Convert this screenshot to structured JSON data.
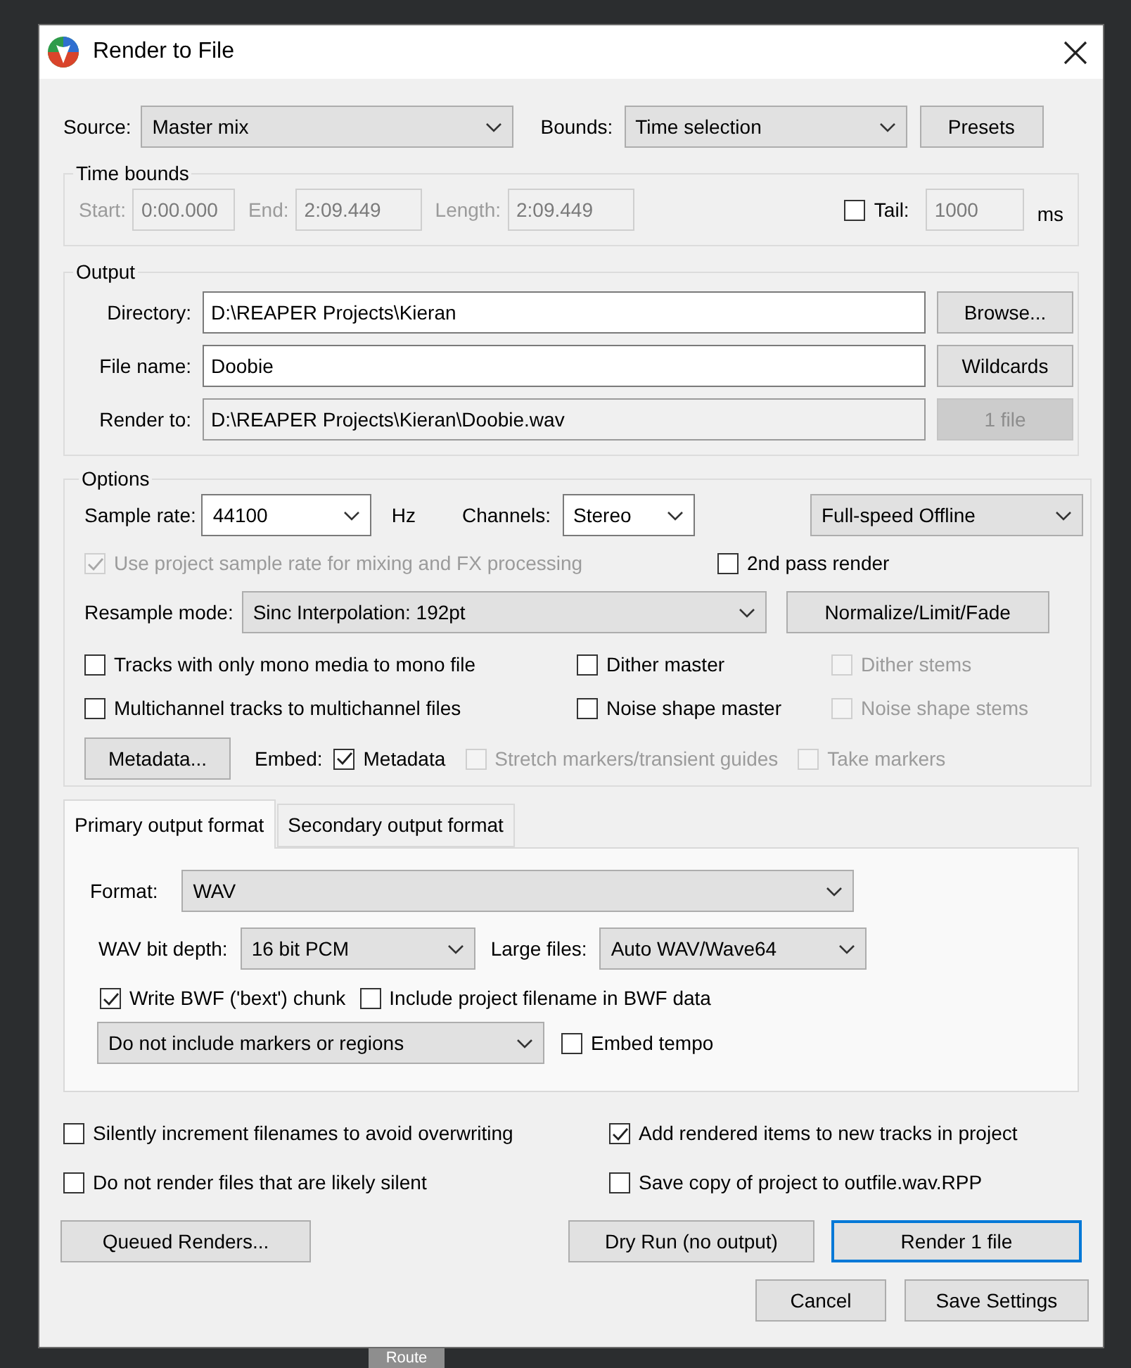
{
  "window": {
    "title": "Render to File"
  },
  "source": {
    "label": "Source:",
    "value": "Master mix"
  },
  "bounds": {
    "label": "Bounds:",
    "value": "Time selection"
  },
  "presets_button": {
    "label": "Presets"
  },
  "time_bounds": {
    "title": "Time bounds",
    "fields": [
      {
        "label": "Start:",
        "value": "0:00.000",
        "disabled": true
      },
      {
        "label": "End:",
        "value": "2:09.449",
        "disabled": true
      },
      {
        "label": "Length:",
        "value": "2:09.449",
        "disabled": true
      }
    ],
    "tail": {
      "label": "Tail:",
      "checked": false,
      "value": "1000",
      "unit": "ms"
    }
  },
  "output": {
    "title": "Output",
    "rows": [
      {
        "label": "Directory:",
        "value": "D:\\REAPER Projects\\Kieran",
        "readonly": false,
        "button": {
          "label": "Browse...",
          "disabled": false
        }
      },
      {
        "label": "File name:",
        "value": "Doobie",
        "readonly": false,
        "button": {
          "label": "Wildcards",
          "disabled": false
        }
      },
      {
        "label": "Render to:",
        "value": "D:\\REAPER Projects\\Kieran\\Doobie.wav",
        "readonly": true,
        "button": {
          "label": "1 file",
          "disabled": true
        }
      }
    ]
  },
  "options": {
    "title": "Options",
    "sample_rate": {
      "label": "Sample rate:",
      "value": "44100",
      "unit": "Hz"
    },
    "channels": {
      "label": "Channels:",
      "value": "Stereo"
    },
    "render_speed": {
      "value": "Full-speed Offline"
    },
    "use_project_rate": {
      "label": "Use project sample rate for mixing and FX processing",
      "checked": true,
      "disabled": true
    },
    "second_pass": {
      "label": "2nd pass render",
      "checked": false,
      "disabled": false
    },
    "resample_mode": {
      "label": "Resample mode:",
      "value": "Sinc Interpolation: 192pt"
    },
    "normalize_button": {
      "label": "Normalize/Limit/Fade"
    },
    "checkboxes": [
      {
        "label": "Tracks with only mono media to mono file",
        "checked": false,
        "disabled": false
      },
      {
        "label": "Dither master",
        "checked": false,
        "disabled": false
      },
      {
        "label": "Dither stems",
        "checked": false,
        "disabled": true
      },
      {
        "label": "Multichannel tracks to multichannel files",
        "checked": false,
        "disabled": false
      },
      {
        "label": "Noise shape master",
        "checked": false,
        "disabled": false
      },
      {
        "label": "Noise shape stems",
        "checked": false,
        "disabled": true
      }
    ],
    "metadata_button": {
      "label": "Metadata..."
    },
    "embed": {
      "label": "Embed:",
      "items": [
        {
          "label": "Metadata",
          "checked": true,
          "disabled": false
        },
        {
          "label": "Stretch markers/transient guides",
          "checked": false,
          "disabled": true
        },
        {
          "label": "Take markers",
          "checked": false,
          "disabled": true
        }
      ]
    }
  },
  "tabs": [
    {
      "label": "Primary output format",
      "selected": true
    },
    {
      "label": "Secondary output format",
      "selected": false
    }
  ],
  "format": {
    "label": "Format:",
    "value": "WAV"
  },
  "wav_bit_depth": {
    "label": "WAV bit depth:",
    "value": "16 bit PCM"
  },
  "large_files": {
    "label": "Large files:",
    "value": "Auto WAV/Wave64"
  },
  "bwf_checkboxes": [
    {
      "label": "Write BWF ('bext') chunk",
      "checked": true
    },
    {
      "label": "Include project filename in BWF data",
      "checked": false
    }
  ],
  "markers": {
    "value": "Do not include markers or regions"
  },
  "embed_tempo": {
    "label": "Embed tempo",
    "checked": false
  },
  "bottom_checkboxes": [
    {
      "label": "Silently increment filenames to avoid overwriting",
      "checked": false
    },
    {
      "label": "Add rendered items to new tracks in project",
      "checked": true
    },
    {
      "label": "Do not render files that are likely silent",
      "checked": false
    },
    {
      "label": "Save copy of project to outfile.wav.RPP",
      "checked": false
    }
  ],
  "buttons": [
    {
      "label": "Queued Renders...",
      "default": false
    },
    {
      "label": "Dry Run (no output)",
      "default": false
    },
    {
      "label": "Render 1 file",
      "default": true
    },
    {
      "label": "Cancel",
      "default": false
    },
    {
      "label": "Save Settings",
      "default": false
    }
  ],
  "background": {
    "label": "Route"
  }
}
